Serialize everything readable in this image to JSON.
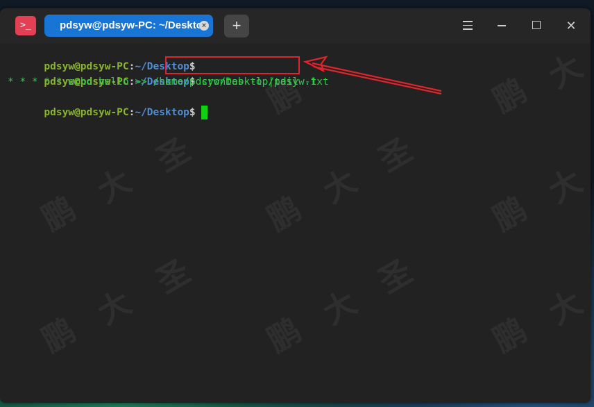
{
  "desktop": {
    "accent_colors": [
      "#1f7a5a",
      "#24507a"
    ]
  },
  "window": {
    "app_icon_glyph": ">_",
    "tab": {
      "title": "pdsyw@pdsyw-PC: ~/Desktop",
      "close_glyph": "×"
    },
    "new_tab_glyph": "+",
    "controls": {
      "menu": "menu-icon",
      "minimize": "minimize-icon",
      "maximize": "maximize-icon",
      "close": "✕"
    }
  },
  "terminal": {
    "prompt": {
      "user": "pdsyw@pdsyw-PC",
      "colon": ":",
      "path": "~/Desktop",
      "dollar": "$"
    },
    "lines": [
      {
        "type": "prompt",
        "command": ""
      },
      {
        "type": "prompt",
        "command": " crontab -l |tail -1"
      },
      {
        "type": "output",
        "text": "* * * * * echo hello >> /home/pdsyw/Desktop/pdsyw.txt"
      },
      {
        "type": "prompt",
        "command": ""
      }
    ],
    "colors": {
      "user": "#8ab52a",
      "path": "#4f8fd6",
      "text": "#2fcc4a",
      "cursor": "#10d010",
      "annotation": "#e0242c"
    }
  },
  "watermark": {
    "chars": [
      "鹏",
      "大",
      "圣"
    ]
  }
}
